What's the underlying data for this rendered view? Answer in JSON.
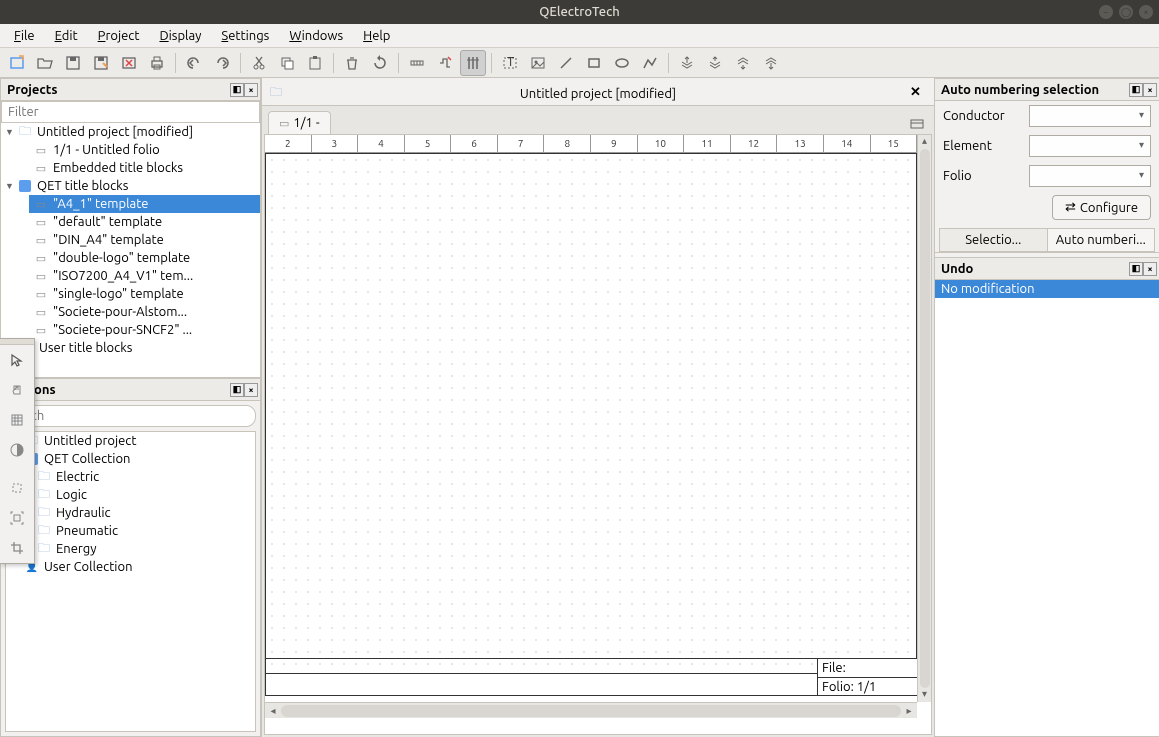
{
  "app_title": "QElectroTech",
  "menu": {
    "file": "File",
    "edit": "Edit",
    "project": "Project",
    "display": "Display",
    "settings": "Settings",
    "windows": "Windows",
    "help": "Help"
  },
  "projects_panel": {
    "title": "Projects",
    "filter_placeholder": "Filter",
    "root": "Untitled project [modified]",
    "folio": "1/1 - Untitled folio",
    "embedded": "Embedded title blocks",
    "qet_blocks": "QET title blocks",
    "templates": [
      "\"A4_1\" template",
      "\"default\" template",
      "\"DIN_A4\" template",
      "\"double-logo\" template",
      "\"ISO7200_A4_V1\" tem...",
      "\"single-logo\" template",
      "\"Societe-pour-Alstom...",
      "\"Societe-pour-SNCF2\" ..."
    ],
    "user_blocks": "User title blocks"
  },
  "collections_panel": {
    "title_suffix": "lections",
    "search_placeholder": "earch",
    "root_project": "Untitled project",
    "qet_collection": "QET Collection",
    "categories": [
      "Electric",
      "Logic",
      "Hydraulic",
      "Pneumatic",
      "Energy"
    ],
    "user_collection": "User Collection"
  },
  "document": {
    "title": "Untitled project [modified]",
    "tab_label": "1/1 -",
    "ruler": [
      "2",
      "3",
      "4",
      "5",
      "6",
      "7",
      "8",
      "9",
      "10",
      "11",
      "12",
      "13",
      "14",
      "15"
    ],
    "file_label": "File:",
    "folio_label": "Folio: 1/1"
  },
  "auto_numbering": {
    "title": "Auto numbering selection",
    "conductor": "Conductor",
    "element": "Element",
    "folio": "Folio",
    "configure": "Configure",
    "tab1": "Selectio...",
    "tab2": "Auto numberi..."
  },
  "undo_panel": {
    "title": "Undo",
    "no_mod": "No modification"
  }
}
